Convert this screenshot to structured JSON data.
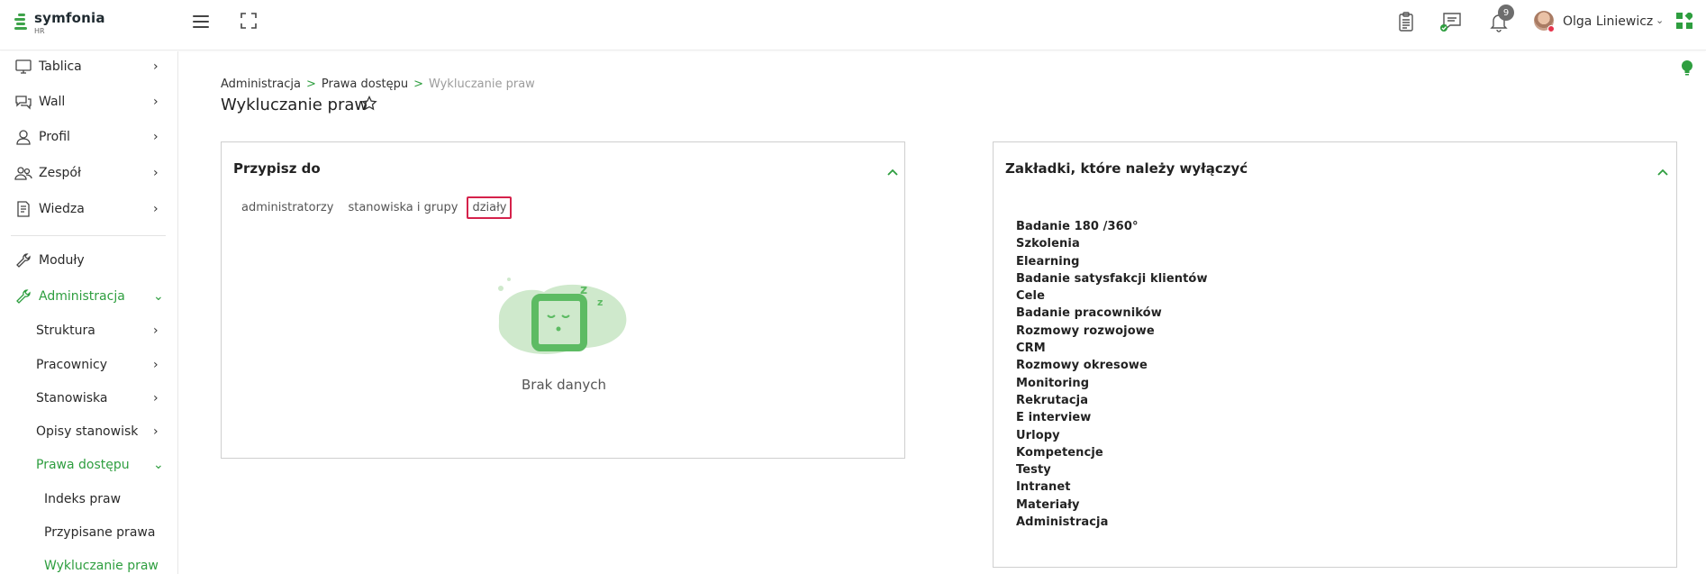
{
  "app": {
    "logo_name": "symfonia",
    "logo_sub": "HR"
  },
  "topbar": {
    "notification_count": "9",
    "user_name": "Olga Liniewicz",
    "user_chevron": "⌄"
  },
  "sidebar": {
    "items": [
      {
        "label": "Tablica",
        "chevron": "›"
      },
      {
        "label": "Wall",
        "chevron": "›"
      },
      {
        "label": "Profil",
        "chevron": "›"
      },
      {
        "label": "Zespół",
        "chevron": "›"
      },
      {
        "label": "Wiedza",
        "chevron": "›"
      },
      {
        "label": "Moduły"
      },
      {
        "label": "Administracja",
        "chevron": "⌄"
      }
    ],
    "admin_sub": [
      {
        "label": "Struktura",
        "chevron": "›"
      },
      {
        "label": "Pracownicy",
        "chevron": "›"
      },
      {
        "label": "Stanowiska",
        "chevron": "›"
      },
      {
        "label": "Opisy stanowisk",
        "chevron": "›"
      },
      {
        "label": "Prawa dostępu",
        "chevron": "⌄"
      }
    ],
    "rights_sub": [
      {
        "label": "Indeks praw"
      },
      {
        "label": "Przypisane prawa"
      },
      {
        "label": "Wykluczanie praw"
      }
    ]
  },
  "breadcrumb": {
    "items": [
      "Administracja",
      "Prawa dostępu",
      "Wykluczanie praw"
    ],
    "separator": ">"
  },
  "page": {
    "title": "Wykluczanie praw"
  },
  "assign_panel": {
    "title": "Przypisz do",
    "tabs": [
      "administratorzy",
      "stanowiska i grupy",
      "działy"
    ],
    "selected_tab": "działy",
    "empty_text": "Brak danych"
  },
  "tabs_panel": {
    "title": "Zakładki, które należy wyłączyć",
    "items": [
      "Badanie 180 /360°",
      "Szkolenia",
      "Elearning",
      "Badanie satysfakcji klientów",
      "Cele",
      "Badanie pracowników",
      "Rozmowy rozwojowe",
      "CRM",
      "Rozmowy okresowe",
      "Monitoring",
      "Rekrutacja",
      "E interview",
      "Urlopy",
      "Kompetencje",
      "Testy",
      "Intranet",
      "Materiały",
      "Administracja"
    ]
  },
  "colors": {
    "accent": "#2e9e3f",
    "selection_border": "#d5224b",
    "illustration": "#5dbb63"
  }
}
